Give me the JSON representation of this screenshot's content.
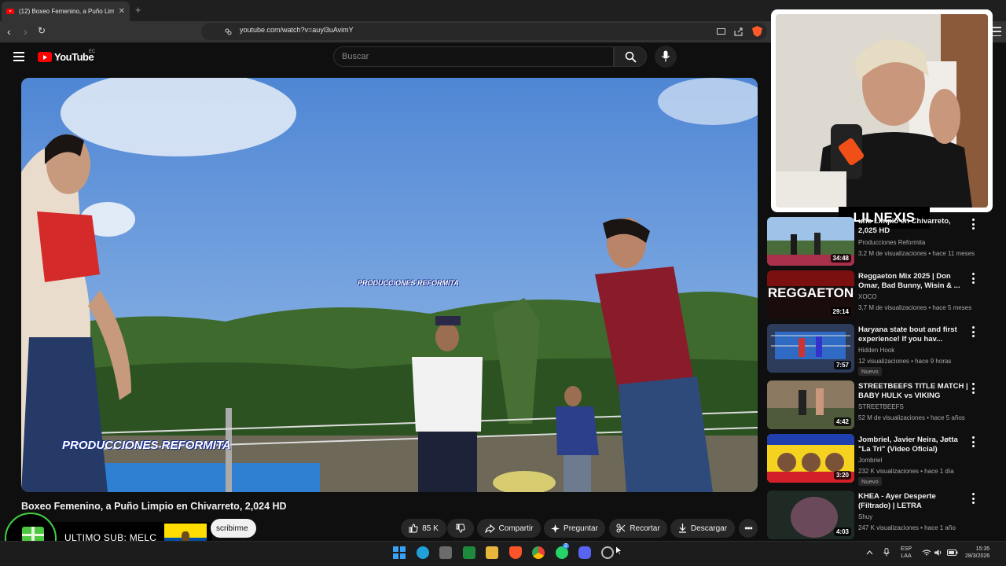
{
  "browser": {
    "tab_title": "(12) Boxeo Femenino, a Puño Lim",
    "url": "youtube.com/watch?v=auyl3uAvimY"
  },
  "youtube": {
    "logo_text": "YouTube",
    "country_code": "EC",
    "search_placeholder": "Buscar"
  },
  "video": {
    "watermark_center": "PRODUCCIONES REFORMITA",
    "watermark_corner": "PRODUCCIONES REFORMITA",
    "title": "Boxeo Femenino, a Puño Limpio en Chivarreto, 2,024 HD",
    "subscribe_label": "scribirme",
    "like_count": "85 K",
    "share_label": "Compartir",
    "ask_label": "Preguntar",
    "clip_label": "Recortar",
    "download_label": "Descargar"
  },
  "overlay": {
    "last_sub_text": "ULTIMO SUB: MELC",
    "streamer_name": "LILNEXIS"
  },
  "recommendations": [
    {
      "title": "Boxeo Femenino, a Puño Limpio en Chivarreto, 2,025 HD",
      "title_visible": "uño Limpio en Chivarreto, 2,025 HD",
      "channel": "Producciones Reformita",
      "meta": "3,2 M de visualizaciones • hace 11 meses",
      "duration": "34:48",
      "badge": ""
    },
    {
      "title": "Reggaeton Mix 2025 | Don Omar, Bad Bunny, Wisin & ...",
      "channel": "XOCO",
      "meta": "3,7 M de visualizaciones • hace 5 meses",
      "duration": "29:14",
      "thumb_text": "REGGAETON",
      "badge": ""
    },
    {
      "title": "Haryana state  bout and first experience! If you hav...",
      "channel": "Hidden Hook",
      "meta": "12 visualizaciones • hace 9 horas",
      "duration": "7:57",
      "badge": "Nuevo"
    },
    {
      "title": "STREETBEEFS TITLE MATCH | BABY HULK vs VIKING",
      "channel": "STREETBEEFS",
      "meta": "52 M de visualizaciones • hace 5 años",
      "duration": "4:42",
      "badge": ""
    },
    {
      "title": "Jombriel, Javier Neira, Jøtta \"La Tri\" (Video Oficial)",
      "channel": "Jombriel",
      "meta": "232 K visualizaciones • hace 1 día",
      "duration": "3:20",
      "badge": "Nuevo"
    },
    {
      "title": "KHEA - Ayer Desperte (Filtrado) | LETRA",
      "channel": "Shuy",
      "meta": "247 K visualizaciones • hace 1 año",
      "duration": "4:03",
      "badge": ""
    }
  ],
  "taskbar": {
    "lang_line1": "ESP",
    "lang_line2": "LAA",
    "time": "15:35",
    "date": "28/3/2026",
    "whatsapp_badge": "2"
  }
}
